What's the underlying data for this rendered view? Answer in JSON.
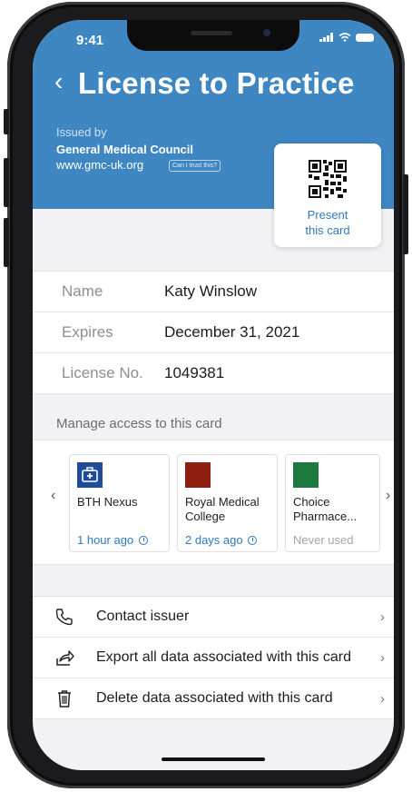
{
  "status": {
    "time": "9:41"
  },
  "header": {
    "back_glyph": "‹",
    "title": "License to Practice",
    "issued_by_label": "Issued by",
    "issuer_name": "General Medical Council",
    "issuer_url": "www.gmc-uk.org",
    "trust_link": "Can I trust this?",
    "accent_color": "#3e87c3"
  },
  "qr": {
    "line1": "Present",
    "line2": "this card"
  },
  "details": [
    {
      "label": "Name",
      "value": "Katy Winslow"
    },
    {
      "label": "Expires",
      "value": "December 31, 2021"
    },
    {
      "label": "License No.",
      "value": "1049381"
    }
  ],
  "access": {
    "title": "Manage access to this card",
    "cards": [
      {
        "name": "BTH Nexus",
        "name2": "",
        "time": "1 hour ago",
        "color": "#1f4b9c",
        "icon": "medical-kit-icon"
      },
      {
        "name": "Royal Medical",
        "name2": "College",
        "time": "2 days ago",
        "color": "#8f1d10",
        "icon": "square-icon"
      },
      {
        "name": "Choice",
        "name2": "Pharmace...",
        "time": "Never used",
        "color": "#1c7a41",
        "icon": "square-icon"
      }
    ]
  },
  "actions": [
    {
      "label": "Contact issuer",
      "icon": "phone-icon"
    },
    {
      "label": "Export all data associated with this card",
      "icon": "share-icon"
    },
    {
      "label": "Delete data associated with this card",
      "icon": "trash-icon"
    }
  ]
}
